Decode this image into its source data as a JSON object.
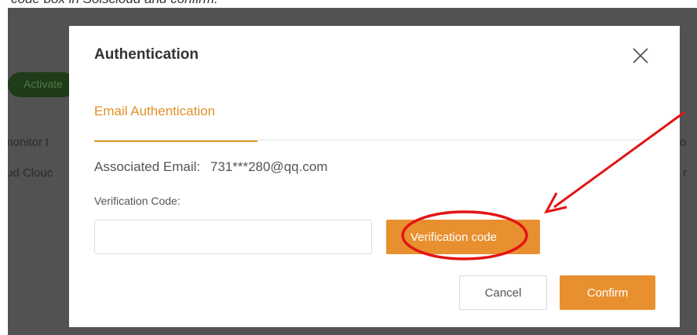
{
  "caption": "code box in Solscloud and confirm.",
  "background": {
    "badge_label": "Activate",
    "left_line1": "monitor t",
    "left_line2": "ud Clouc",
    "right_line1": "o",
    "right_line2": "r"
  },
  "dialog": {
    "title": "Authentication",
    "close_icon": "close-icon",
    "tab_label": "Email Authentication",
    "associated_email_label": "Associated Email:",
    "associated_email_value": "731***280@qq.com",
    "verification_code_label": "Verification Code:",
    "verification_code_value": "",
    "send_code_label": "Verification code",
    "cancel_label": "Cancel",
    "confirm_label": "Confirm"
  },
  "colors": {
    "accent": "#e8902f",
    "annotation": "#e31414",
    "overlay": "#525252"
  }
}
